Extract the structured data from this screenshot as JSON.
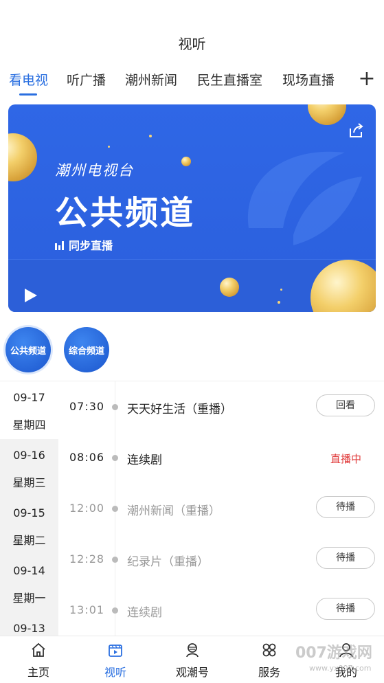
{
  "header": {
    "title": "视听"
  },
  "tabs": [
    {
      "label": "看电视",
      "active": true
    },
    {
      "label": "听广播"
    },
    {
      "label": "潮州新闻"
    },
    {
      "label": "民生直播室"
    },
    {
      "label": "现场直播"
    }
  ],
  "tab_add_icon": "plus-icon",
  "banner": {
    "brand": "潮州电视台",
    "channel_name": "公共频道",
    "live_sync": "同步直播",
    "icons": [
      "share-icon",
      "play-icon",
      "bars-icon"
    ],
    "colors": {
      "bg": "#2f67e6",
      "gold": "#f3cf6a"
    }
  },
  "channels": [
    {
      "label": "公共频道",
      "active": true
    },
    {
      "label": "综合频道"
    }
  ],
  "dates": [
    {
      "date": "09-17",
      "weekday": "星期四",
      "active": true
    },
    {
      "date": "09-16",
      "weekday": "星期三"
    },
    {
      "date": "09-15",
      "weekday": "星期二"
    },
    {
      "date": "09-14",
      "weekday": "星期一"
    },
    {
      "date": "09-13",
      "weekday": ""
    }
  ],
  "schedule": [
    {
      "time": "07:30",
      "program": "天天好生活（重播）",
      "action": "回看"
    },
    {
      "time": "08:06",
      "program": "连续剧",
      "status": "直播中"
    },
    {
      "time": "12:00",
      "program": "潮州新闻（重播）",
      "action": "待播"
    },
    {
      "time": "12:28",
      "program": "纪录片（重播）",
      "action": "待播"
    },
    {
      "time": "13:01",
      "program": "连续剧",
      "action": "待播"
    }
  ],
  "bottom_nav": [
    {
      "label": "主页",
      "icon": "home-icon"
    },
    {
      "label": "视听",
      "icon": "video-icon",
      "active": true
    },
    {
      "label": "观潮号",
      "icon": "person-badge-icon"
    },
    {
      "label": "服务",
      "icon": "grid-flower-icon"
    },
    {
      "label": "我的",
      "icon": "user-icon"
    }
  ],
  "watermark": {
    "main": "007游戏网",
    "sub": "www.yx007.com"
  },
  "colors": {
    "accent": "#2a6fe0",
    "live": "#e03a3a"
  }
}
